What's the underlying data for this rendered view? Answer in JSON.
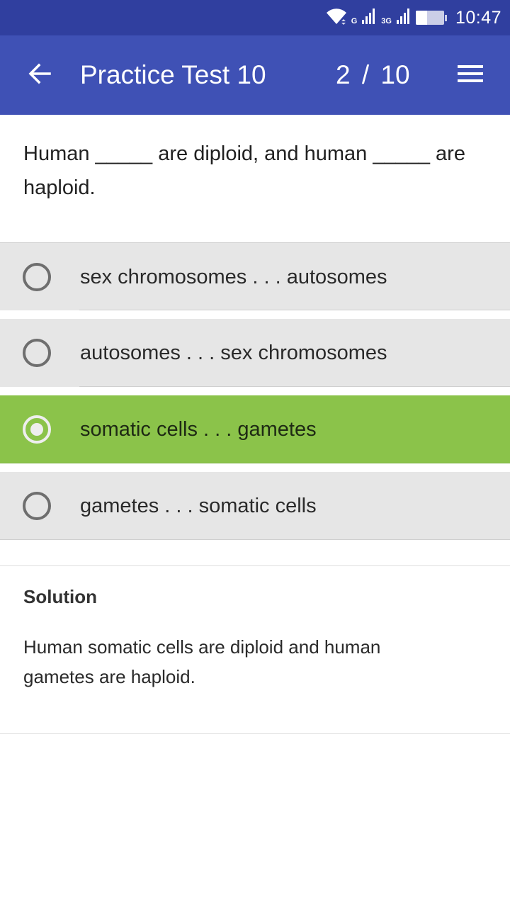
{
  "status_bar": {
    "time": "10:47",
    "network_1_label": "G",
    "network_2_label": "3G",
    "battery_level": 0.4,
    "icons": [
      "wifi-icon",
      "signal-icon",
      "signal-icon",
      "battery-icon"
    ]
  },
  "toolbar": {
    "back_icon": "arrow-left-icon",
    "title": "Practice Test 10",
    "progress": "2 / 10",
    "menu_icon": "hamburger-menu-icon"
  },
  "question": {
    "text": "Human _____ are diploid, and human _____ are haploid."
  },
  "options": [
    {
      "label": "sex chromosomes . . . autosomes",
      "selected": false
    },
    {
      "label": "autosomes . . . sex chromosomes",
      "selected": false
    },
    {
      "label": "somatic cells . . . gametes",
      "selected": true
    },
    {
      "label": "gametes . . . somatic cells",
      "selected": false
    }
  ],
  "solution": {
    "title": "Solution",
    "body": "Human somatic cells are diploid and human gametes are haploid."
  },
  "colors": {
    "status_bar": "#303F9F",
    "toolbar": "#3F51B5",
    "option_bg": "#E6E6E6",
    "selected_option_bg": "#8BC34A"
  }
}
